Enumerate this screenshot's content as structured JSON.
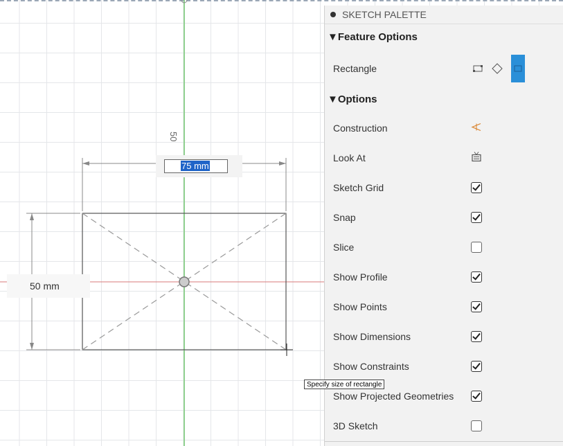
{
  "canvas": {
    "dimension_horizontal": "75 mm",
    "dimension_vertical": "50 mm",
    "dimension_vertical_rotated": "50",
    "tooltip": "Specify size of rectangle",
    "colors": {
      "y_axis": "#8fd08f",
      "x_axis": "#d97a7a",
      "selection": "#1f64c8"
    }
  },
  "palette": {
    "title": "SKETCH PALETTE",
    "feature_options_label": "▼Feature Options",
    "rectangle_label": "Rectangle",
    "rectangle_tools": [
      "two-point-rectangle-icon",
      "three-point-rectangle-icon",
      "center-rectangle-icon"
    ],
    "options_label": "▼Options",
    "rows": [
      {
        "label": "Construction",
        "control": "construction-icon"
      },
      {
        "label": "Look At",
        "control": "look-at-icon"
      },
      {
        "label": "Sketch Grid",
        "control": "checkbox",
        "checked": true
      },
      {
        "label": "Snap",
        "control": "checkbox",
        "checked": true
      },
      {
        "label": "Slice",
        "control": "checkbox",
        "checked": false
      },
      {
        "label": "Show Profile",
        "control": "checkbox",
        "checked": true
      },
      {
        "label": "Show Points",
        "control": "checkbox",
        "checked": true
      },
      {
        "label": "Show Dimensions",
        "control": "checkbox",
        "checked": true
      },
      {
        "label": "Show Constraints",
        "control": "checkbox",
        "checked": true
      },
      {
        "label": "Show Projected Geometries",
        "control": "checkbox",
        "checked": true
      },
      {
        "label": "3D Sketch",
        "control": "checkbox",
        "checked": false
      }
    ],
    "accent": "#2a8fd8"
  }
}
